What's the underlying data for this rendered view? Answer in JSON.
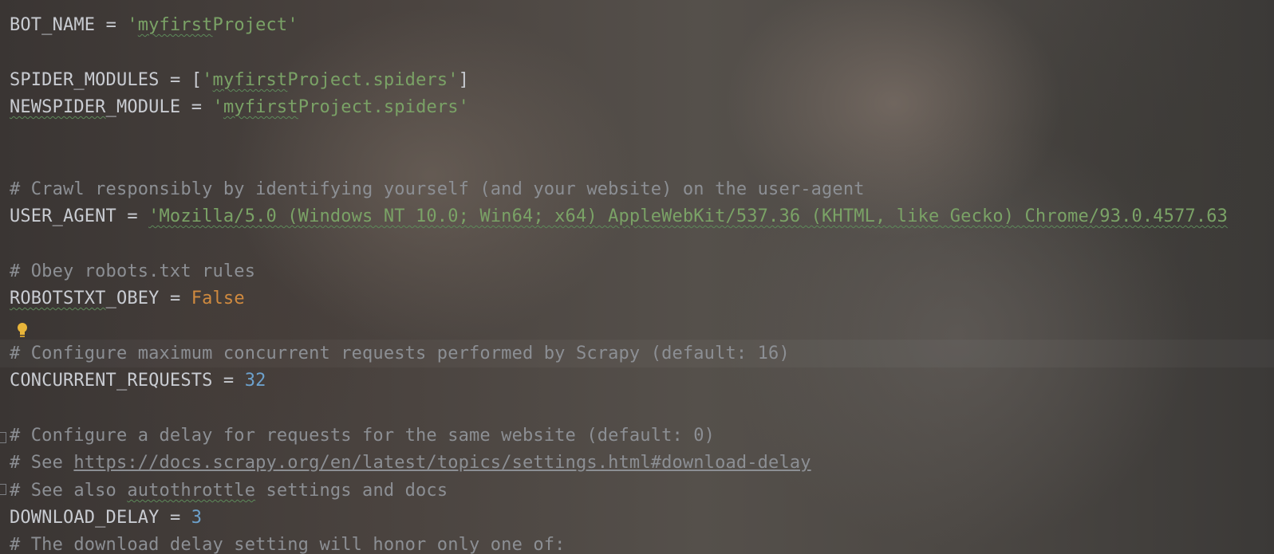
{
  "editor": {
    "lines": {
      "l1": {
        "name": "BOT_NAME",
        "op": " = ",
        "value_open": "'",
        "value_typo": "myfirst",
        "value_rest": "Project",
        "value_close": "'"
      },
      "l3": {
        "name": "SPIDER_MODULES",
        "op": " = ",
        "bracket_open": "[",
        "value_open": "'",
        "value_typo": "myfirst",
        "value_rest": "Project.spiders",
        "value_close": "'",
        "bracket_close": "]"
      },
      "l4": {
        "name_typo": "NEWSPIDER",
        "name_rest": "_MODULE",
        "op": " = ",
        "value_open": "'",
        "value_typo": "myfirst",
        "value_rest": "Project.spiders",
        "value_close": "'"
      },
      "l7": {
        "comment": "# Crawl responsibly by identifying yourself (and your website) on the user-agent"
      },
      "l8": {
        "name": "USER_AGENT",
        "op": " = ",
        "value": "'Mozilla/5.0 (Windows NT 10.0; Win64; x64) AppleWebKit/537.36 (KHTML, like Gecko) Chrome/93.0.4577.63"
      },
      "l10": {
        "comment": "# Obey robots.txt rules"
      },
      "l11": {
        "name_typo": "ROBOTSTXT",
        "name_rest": "_OBEY",
        "op": " = ",
        "value": "False"
      },
      "l13": {
        "comment": "# Configure maximum concurrent requests performed by Scrapy (default: 16)"
      },
      "l14": {
        "name": "CONCURRENT_REQUESTS",
        "op": " = ",
        "value": "32"
      },
      "l16": {
        "comment": "# Configure a delay for requests for the same website (default: 0)"
      },
      "l17": {
        "comment_prefix": "# See ",
        "link": "https://docs.scrapy.org/en/latest/topics/settings.html#download-delay"
      },
      "l18": {
        "comment_prefix": "# See also ",
        "comment_typo": "autothrottle",
        "comment_rest": " settings and docs"
      },
      "l19": {
        "name": "DOWNLOAD_DELAY",
        "op": " = ",
        "value": "3"
      },
      "l20": {
        "comment": "# The download delay setting will honor only one of:"
      }
    },
    "gutter_icon": "lightbulb-icon",
    "colors": {
      "identifier": "#c9ccd2",
      "string": "#7aa266",
      "keyword": "#d08a3f",
      "number": "#6da1cc",
      "comment": "#8c8f94",
      "bulb": "#e8b53a"
    }
  }
}
